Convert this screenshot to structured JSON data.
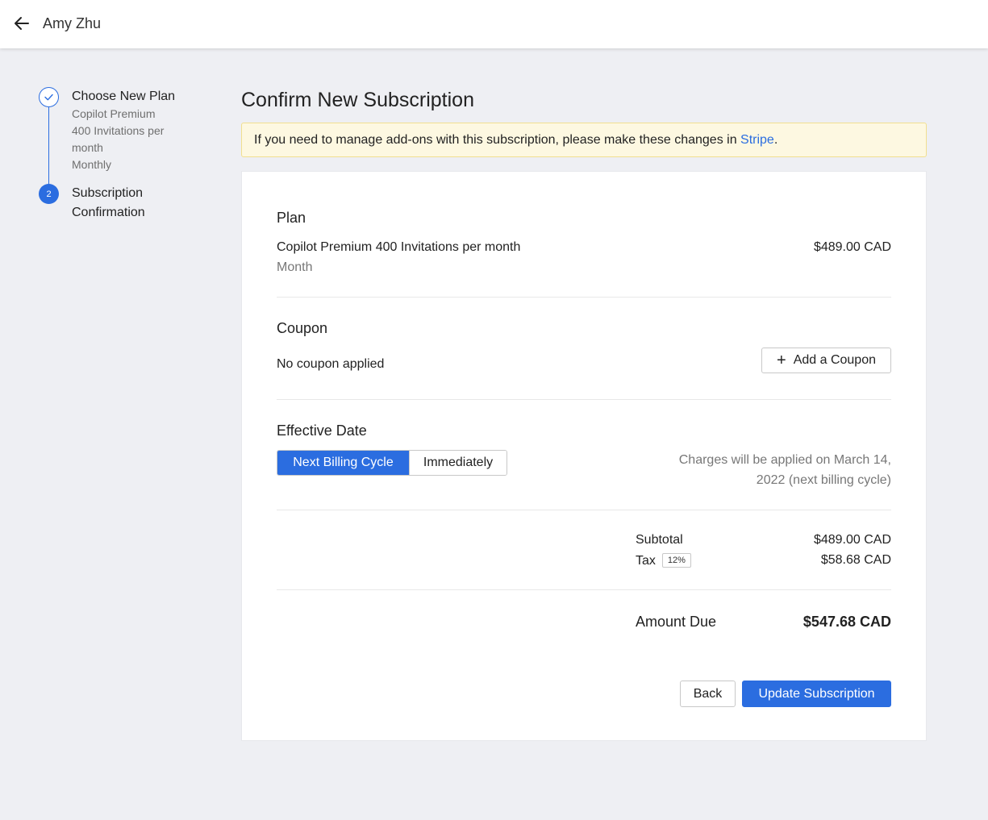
{
  "header": {
    "back_icon": "arrow-left-icon",
    "user_name": "Amy Zhu"
  },
  "stepper": {
    "steps": [
      {
        "title": "Choose New Plan",
        "status": "done",
        "icon": "check-icon",
        "details": [
          "Copilot Premium",
          "400 Invitations per",
          "month",
          "Monthly"
        ]
      },
      {
        "number": "2",
        "title_line1": "Subscription",
        "title_line2": "Confirmation",
        "status": "active"
      }
    ]
  },
  "page": {
    "title": "Confirm New Subscription",
    "notice_text": "If you need to manage add-ons with this subscription, please make these changes in ",
    "notice_link": "Stripe",
    "notice_end": "."
  },
  "plan": {
    "heading": "Plan",
    "name": "Copilot Premium 400 Invitations per month",
    "interval": "Month",
    "price": "$489.00 CAD"
  },
  "coupon": {
    "heading": "Coupon",
    "status": "No coupon applied",
    "add_icon": "plus-icon",
    "add_label": "Add a Coupon"
  },
  "effective_date": {
    "heading": "Effective Date",
    "options": [
      "Next Billing Cycle",
      "Immediately"
    ],
    "selected": "Next Billing Cycle",
    "note_line1": "Charges will be applied on March 14,",
    "note_line2": "2022 (next billing cycle)"
  },
  "totals": {
    "subtotal_label": "Subtotal",
    "subtotal_value": "$489.00 CAD",
    "tax_label": "Tax",
    "tax_rate": "12%",
    "tax_value": "$58.68 CAD",
    "amount_due_label": "Amount Due",
    "amount_due_value": "$547.68 CAD"
  },
  "actions": {
    "back_label": "Back",
    "submit_label": "Update Subscription"
  },
  "colors": {
    "accent": "#2b6de0",
    "notice_bg": "#fdf8e1",
    "page_bg": "#eeeff3"
  }
}
